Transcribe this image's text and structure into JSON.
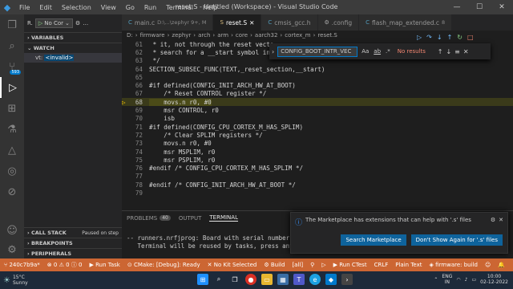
{
  "titlebar": {
    "menu": [
      "File",
      "Edit",
      "Selection",
      "View",
      "Go",
      "Run",
      "Terminal",
      "Help"
    ],
    "title": "reset.S - Untitled (Workspace) - Visual Studio Code"
  },
  "sidebar": {
    "run_label": "R.",
    "config": "No Cor",
    "sections": {
      "variables": "VARIABLES",
      "watch": "WATCH",
      "watch_item_name": "vt:",
      "watch_item_value": "<invalid>",
      "call_stack": "CALL STACK",
      "call_stack_status": "Paused on step",
      "breakpoints": "BREAKPOINTS",
      "peripherals": "PERIPHERALS"
    },
    "badge_count": "593"
  },
  "tabs": [
    {
      "label": "main.c",
      "detail": "D:\\...\\zephyr 9+, M",
      "icon": "C"
    },
    {
      "label": "reset.S",
      "detail": "",
      "icon": "S",
      "active": true
    },
    {
      "label": "cmsis_gcc.h",
      "detail": "",
      "icon": "C"
    },
    {
      "label": ".config",
      "detail": "",
      "icon": "⚙"
    },
    {
      "label": "flash_map_extended.c",
      "detail": "8",
      "icon": "C"
    }
  ],
  "breadcrumb": [
    "D:",
    "firmware",
    "zephyr",
    "arch",
    "arm",
    "core",
    "aarch32",
    "cortex_m",
    "reset.S"
  ],
  "find": {
    "query": "CONFIG_BOOT_INTR_VEC",
    "opts": [
      "Aa",
      "ab",
      ".*"
    ],
    "result": "No results"
  },
  "code": [
    {
      "n": "61",
      "t": " * it, not through the reset vecto"
    },
    {
      "n": "62",
      "t": " * search for a __start symbol in"
    },
    {
      "n": "63",
      "t": " */"
    },
    {
      "n": "64",
      "t": "SECTION_SUBSEC_FUNC(TEXT,_reset_section,__start)"
    },
    {
      "n": "65",
      "t": ""
    },
    {
      "n": "66",
      "t": "#if defined(CONFIG_INIT_ARCH_HW_AT_BOOT)"
    },
    {
      "n": "67",
      "t": "    /* Reset CONTROL register */"
    },
    {
      "n": "68",
      "t": "    movs.n r0, #0",
      "cur": true
    },
    {
      "n": "69",
      "t": "    msr CONTROL, r0"
    },
    {
      "n": "70",
      "t": "    isb"
    },
    {
      "n": "71",
      "t": "#if defined(CONFIG_CPU_CORTEX_M_HAS_SPLIM)"
    },
    {
      "n": "72",
      "t": "    /* Clear SPLIM registers */"
    },
    {
      "n": "73",
      "t": "    movs.n r0, #0"
    },
    {
      "n": "74",
      "t": "    msr MSPLIM, r0"
    },
    {
      "n": "75",
      "t": "    msr PSPLIM, r0"
    },
    {
      "n": "76",
      "t": "#endif /* CONFIG_CPU_CORTEX_M_HAS_SPLIM */"
    },
    {
      "n": "77",
      "t": ""
    },
    {
      "n": "78",
      "t": "#endif /* CONFIG_INIT_ARCH_HW_AT_BOOT */"
    },
    {
      "n": "79",
      "t": ""
    }
  ],
  "panel": {
    "problems": "PROBLEMS",
    "problems_count": "40",
    "output": "OUTPUT",
    "terminal": "TERMINAL"
  },
  "terminal": [
    "-- runners.nrfjprog: Board with serial number 96",
    "   Terminal will be reused by tasks, press any"
  ],
  "toast": {
    "message": "The Marketplace has extensions that can help with '.s' files",
    "btn1": "Search Marketplace",
    "btn2": "Don't Show Again for '.s' files"
  },
  "status": {
    "branch": "240c7b9a*",
    "errors": "0",
    "warnings": "0",
    "info": "0",
    "run_task": "Run Task",
    "cmake": "CMake: [Debug]: Ready",
    "kit": "No Kit Selected",
    "build": "Build",
    "target": "[all]",
    "ctest": "Run CTest",
    "eol": "CRLF",
    "lang": "Plain Text",
    "firmware": "firmware: build"
  },
  "taskbar": {
    "temp": "15°C",
    "weather": "Sunny",
    "lang": "ENG",
    "region": "IN",
    "time": "10:00",
    "date": "02-12-2022"
  },
  "colors": {
    "status_bg": "#cc6633",
    "accent": "#007acc"
  }
}
